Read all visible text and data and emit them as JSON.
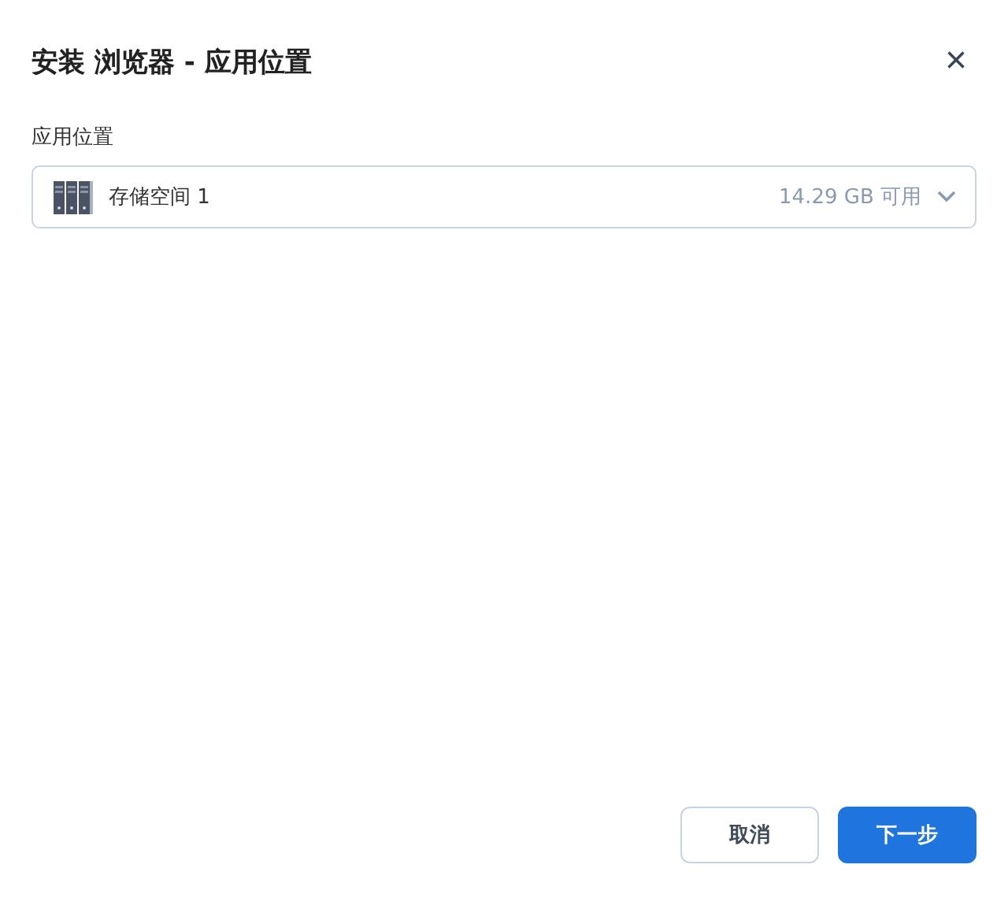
{
  "dialog": {
    "title": "安装 浏览器 - 应用位置",
    "close": "×"
  },
  "field": {
    "label": "应用位置",
    "value": "存储空间 1",
    "hint": "14.29 GB 可用"
  },
  "buttons": [
    {
      "label": "取消",
      "kind": "secondary"
    },
    {
      "label": "下一步",
      "kind": "primary"
    }
  ]
}
